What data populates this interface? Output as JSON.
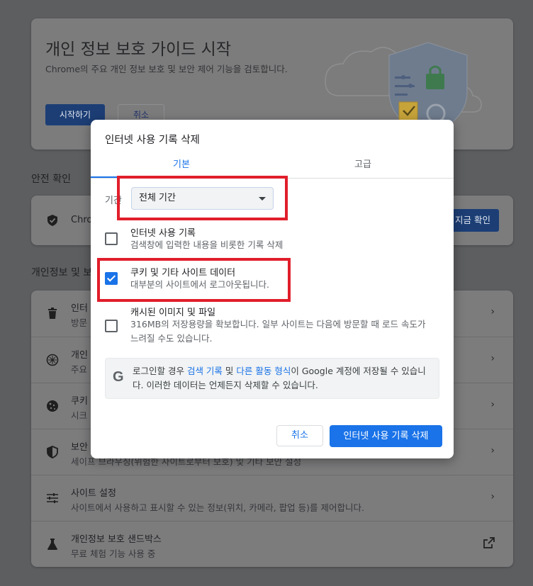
{
  "guide": {
    "title": "개인 정보 보호 가이드 시작",
    "description": "Chrome의 주요 개인 정보 보호 및 보안 제어 기능을 검토합니다.",
    "start_label": "시작하기",
    "cancel_label": "취소"
  },
  "safety": {
    "heading": "안전 확인",
    "row_text": "Chro",
    "button_label": "지금 확인"
  },
  "privacy": {
    "heading": "개인정보 및 보",
    "rows": [
      {
        "title": "인터",
        "sub": "방문",
        "icon": "trash-icon"
      },
      {
        "title": "개인",
        "sub": "주요",
        "icon": "compass-icon"
      },
      {
        "title": "쿠키",
        "sub": "시크",
        "icon": "cookie-icon"
      },
      {
        "title": "보안",
        "sub": "세이프 브라우징(위험한 사이트로부터 보호) 및 기타 보안 설정",
        "icon": "shield-icon"
      },
      {
        "title": "사이트 설정",
        "sub": "사이트에서 사용하고 표시할 수 있는 정보(위치, 카메라, 팝업 등)를 제어합니다.",
        "icon": "sliders-icon"
      },
      {
        "title": "개인정보 보호 샌드박스",
        "sub": "무료 체험 기능 사용 중",
        "icon": "flask-icon"
      }
    ]
  },
  "dialog": {
    "title": "인터넷 사용 기록 삭제",
    "tabs": [
      "기본",
      "고급"
    ],
    "active_tab": "기본",
    "period_label": "기간",
    "period_value": "전체 기간",
    "options": [
      {
        "title": "인터넷 사용 기록",
        "sub": "검색창에 입력한 내용을 비롯한 기록 삭제",
        "checked": false
      },
      {
        "title": "쿠키 및 기타 사이트 데이터",
        "sub": "대부분의 사이트에서 로그아웃됩니다.",
        "checked": true
      },
      {
        "title": "캐시된 이미지 및 파일",
        "sub": "316MB의 저장용량을 확보합니다. 일부 사이트는 다음에 방문할 때 로드 속도가 느려질 수도 있습니다.",
        "checked": false
      }
    ],
    "info": {
      "prefix": "로그인할 경우 ",
      "link1": "검색 기록",
      "mid": " 및 ",
      "link2": "다른 활동 형식",
      "suffix": "이 Google 계정에 저장될 수 있습니다. 이러한 데이터는 언제든지 삭제할 수 있습니다."
    },
    "cancel_label": "취소",
    "delete_label": "인터넷 사용 기록 삭제"
  },
  "colors": {
    "accent": "#1a73e8",
    "highlight": "#e11e2b",
    "backdrop": "#5d5e60"
  }
}
